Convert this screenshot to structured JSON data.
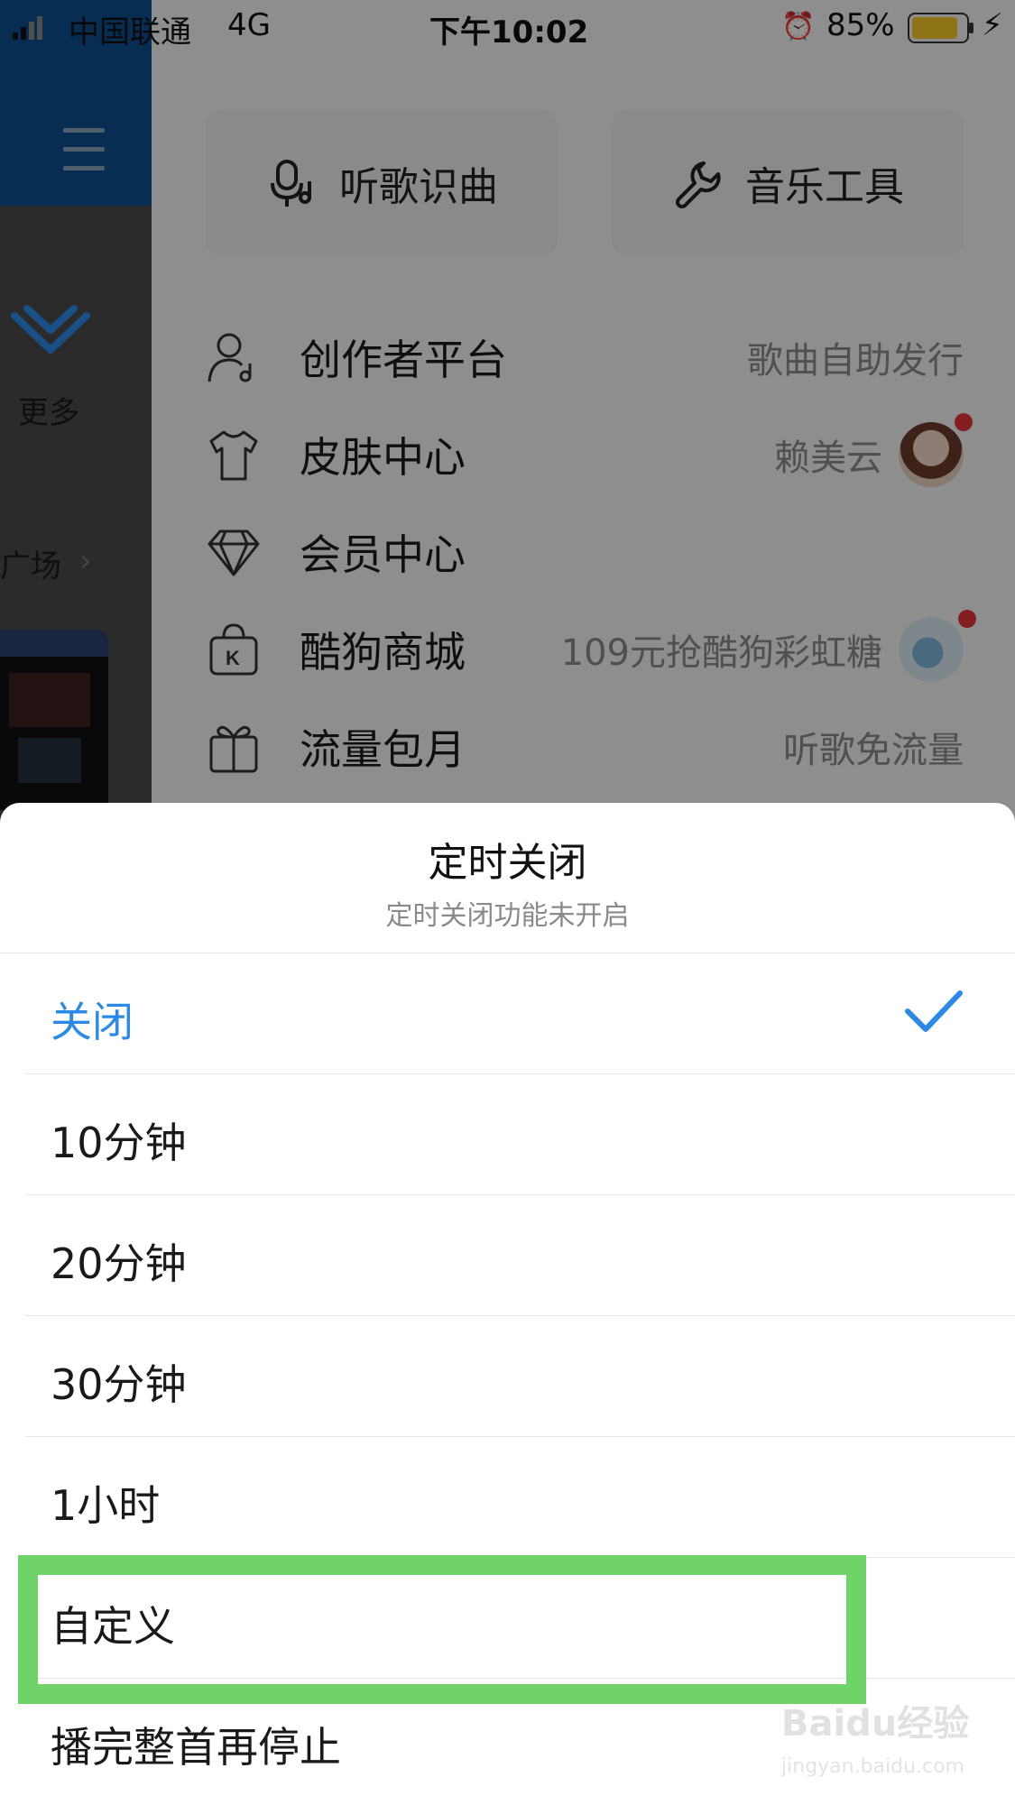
{
  "status_bar": {
    "carrier": "中国联通",
    "network": "4G",
    "time": "下午10:02",
    "battery": "85%"
  },
  "left_panel": {
    "more_label": "更多",
    "square_label": "广场"
  },
  "tools": {
    "recognize_label": "听歌识曲",
    "tools_label": "音乐工具"
  },
  "menu": [
    {
      "label": "创作者平台",
      "sub": "歌曲自助发行",
      "icon": "creator-icon"
    },
    {
      "label": "皮肤中心",
      "sub": "赖美云",
      "icon": "shirt-icon"
    },
    {
      "label": "会员中心",
      "sub": "",
      "icon": "diamond-icon"
    },
    {
      "label": "酷狗商城",
      "sub": "109元抢酷狗彩虹糖",
      "icon": "shop-bag-icon"
    },
    {
      "label": "流量包月",
      "sub": "听歌免流量",
      "icon": "gift-icon"
    }
  ],
  "sheet": {
    "title": "定时关闭",
    "subtitle": "定时关闭功能未开启",
    "options": [
      {
        "label": "关闭",
        "selected": true
      },
      {
        "label": "10分钟",
        "selected": false
      },
      {
        "label": "20分钟",
        "selected": false
      },
      {
        "label": "30分钟",
        "selected": false
      },
      {
        "label": "1小时",
        "selected": false
      },
      {
        "label": "自定义",
        "selected": false
      },
      {
        "label": "播完整首再停止",
        "selected": false
      }
    ],
    "accent_color": "#2b8ae8",
    "highlight_color": "#6fd36a"
  },
  "watermark": {
    "logo": "Baidu经验",
    "url": "jingyan.baidu.com"
  }
}
